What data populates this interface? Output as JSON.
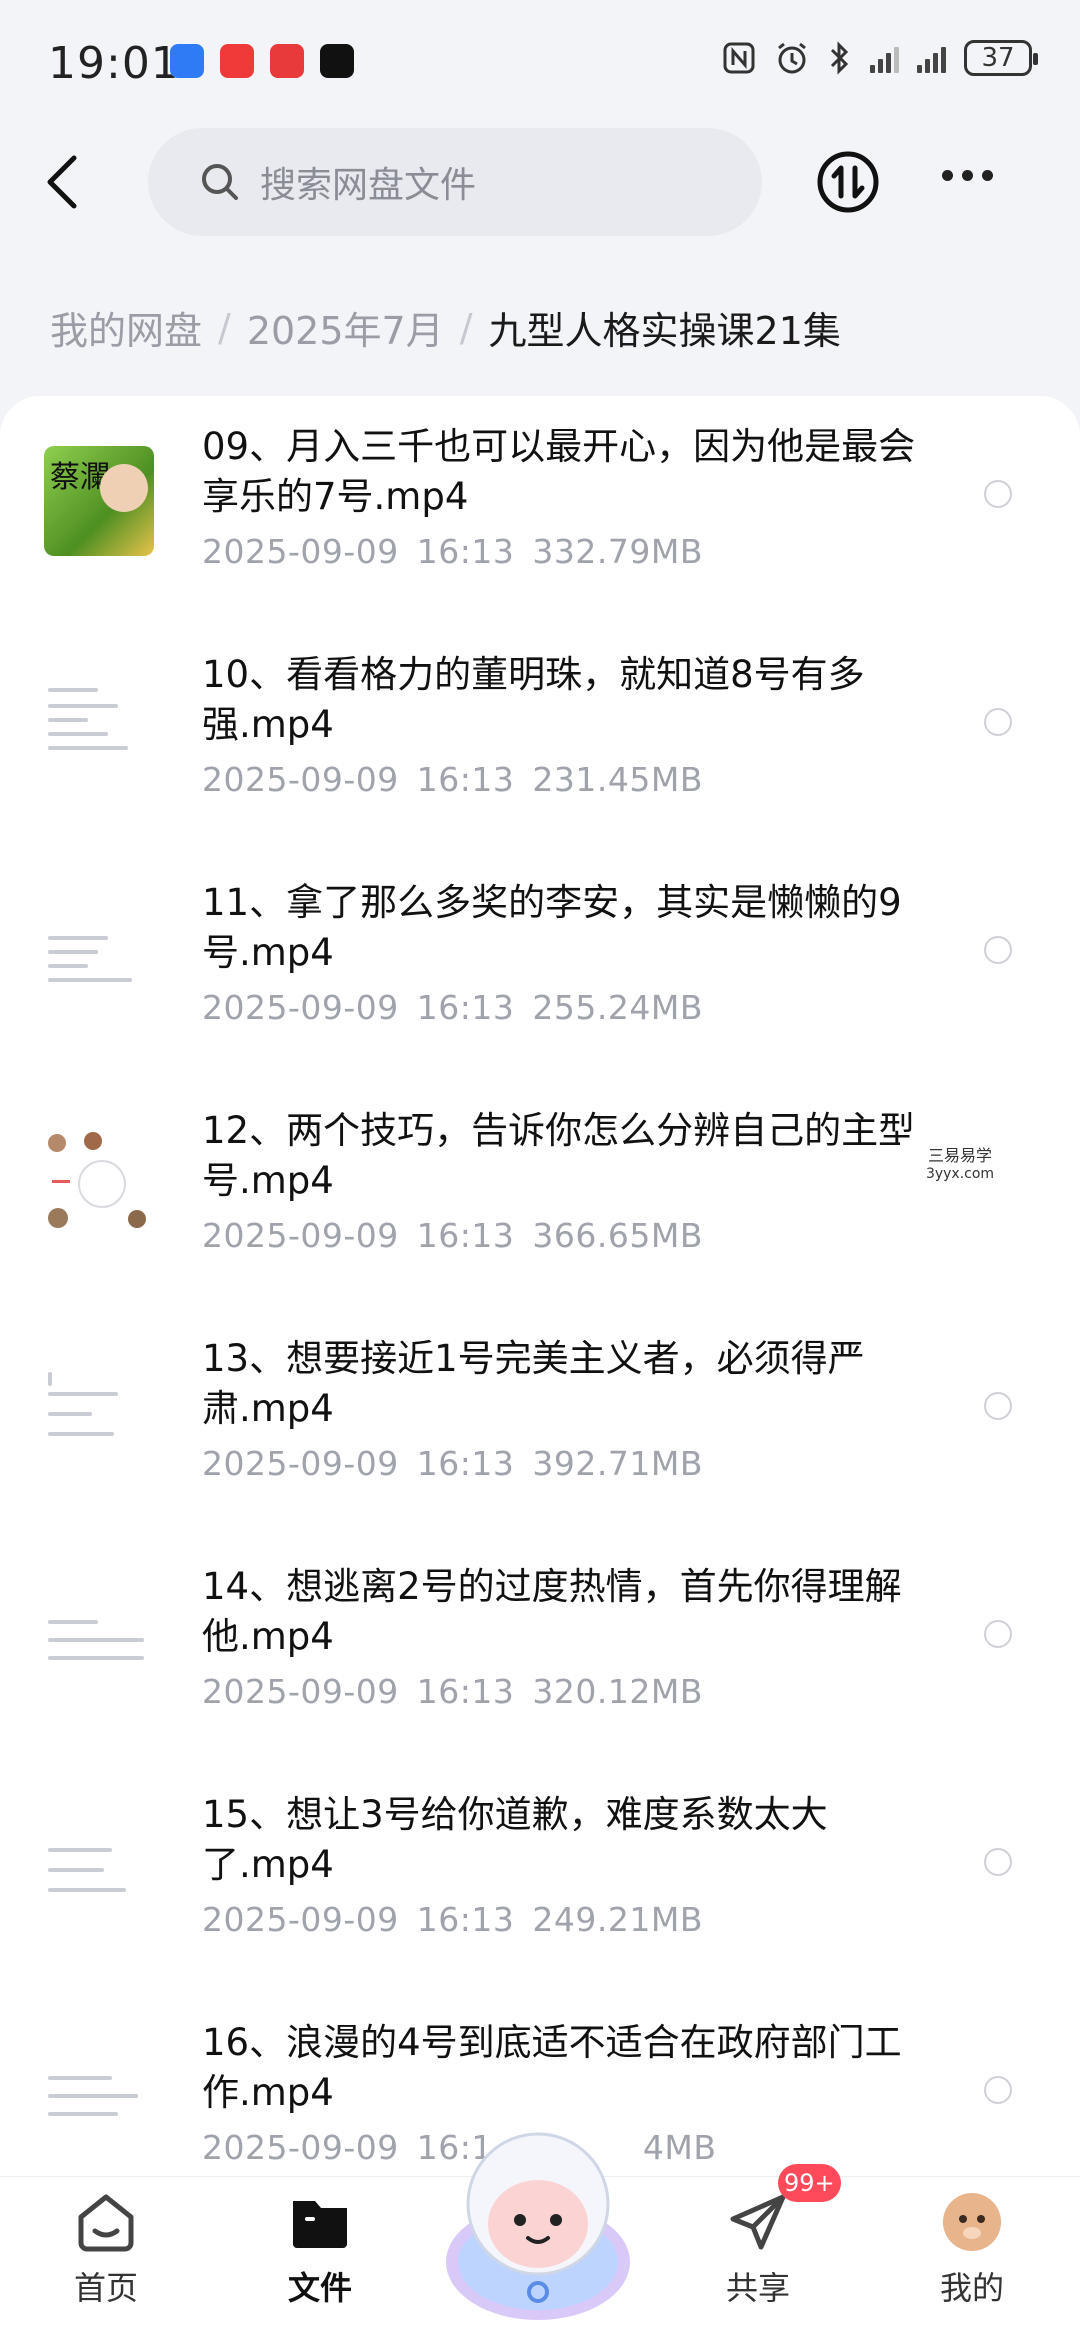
{
  "status_bar": {
    "time": "19:01",
    "battery": "37"
  },
  "header": {
    "search_placeholder": "搜索网盘文件"
  },
  "breadcrumb": {
    "items": [
      "我的网盘",
      "2025年7月"
    ],
    "current": "九型人格实操课21集"
  },
  "files": [
    {
      "title": "09、月入三千也可以最开心，因为他是最会享乐的7号.mp4",
      "date": "2025-09-09",
      "time": "16:13",
      "size": "332.79MB",
      "thumb_text": "蔡瀾"
    },
    {
      "title": "10、看看格力的董明珠，就知道8号有多强.mp4",
      "date": "2025-09-09",
      "time": "16:13",
      "size": "231.45MB"
    },
    {
      "title": "11、拿了那么多奖的李安，其实是懒懒的9号.mp4",
      "date": "2025-09-09",
      "time": "16:13",
      "size": "255.24MB"
    },
    {
      "title": "12、两个技巧，告诉你怎么分辨自己的主型号.mp4",
      "date": "2025-09-09",
      "time": "16:13",
      "size": "366.65MB"
    },
    {
      "title": "13、想要接近1号完美主义者，必须得严肃.mp4",
      "date": "2025-09-09",
      "time": "16:13",
      "size": "392.71MB"
    },
    {
      "title": "14、想逃离2号的过度热情，首先你得理解他.mp4",
      "date": "2025-09-09",
      "time": "16:13",
      "size": "320.12MB"
    },
    {
      "title": "15、想让3号给你道歉，难度系数太大了.mp4",
      "date": "2025-09-09",
      "time": "16:13",
      "size": "249.21MB"
    },
    {
      "title": "16、浪漫的4号到底适不适合在政府部门工作.mp4",
      "date": "2025-09-09",
      "time": "16:1",
      "size": "4MB"
    }
  ],
  "watermark": {
    "line1": "三易易学",
    "line2": "3yyx.com"
  },
  "bottom_nav": [
    {
      "label": "首页",
      "icon": "home-icon"
    },
    {
      "label": "文件",
      "icon": "folder-icon",
      "active": true
    },
    {
      "label": "共享",
      "icon": "share-icon",
      "badge": "99+"
    },
    {
      "label": "我的",
      "icon": "avatar-icon"
    }
  ]
}
